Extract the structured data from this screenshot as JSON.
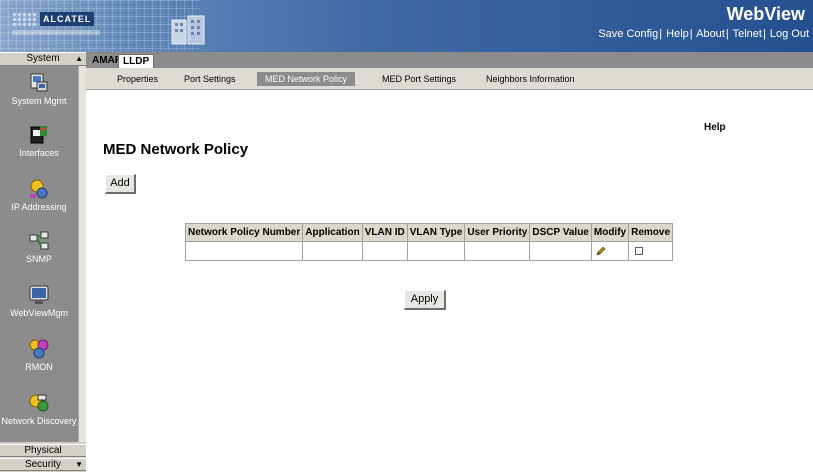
{
  "header": {
    "logo_text": "ALCATEL",
    "app_title": "WebView",
    "links": [
      "Save Config",
      "Help",
      "About",
      "Telnet",
      "Log Out"
    ],
    "separator": "|"
  },
  "sidebar": {
    "top_label": "System",
    "items": [
      {
        "label": "System Mgmt",
        "icon": "system-mgmt-icon"
      },
      {
        "label": "Interfaces",
        "icon": "interfaces-icon"
      },
      {
        "label": "IP Addressing",
        "icon": "ip-addressing-icon"
      },
      {
        "label": "SNMP",
        "icon": "snmp-icon"
      },
      {
        "label": "WebViewMgm",
        "icon": "webview-mgmt-icon"
      },
      {
        "label": "RMON",
        "icon": "rmon-icon"
      },
      {
        "label": "Network Discovery",
        "icon": "network-discovery-icon"
      }
    ],
    "bottom_items": [
      "Physical",
      "Security"
    ]
  },
  "main_tabs": [
    "AMAP",
    "LLDP"
  ],
  "sub_tabs": [
    "Properties",
    "Port Settings",
    "MED Network Policy",
    "MED Port Settings",
    "Neighbors Information"
  ],
  "active_sub_tab": "MED Network Policy",
  "content": {
    "help_label": "Help",
    "title": "MED Network Policy",
    "add_label": "Add",
    "apply_label": "Apply",
    "table": {
      "columns": [
        "Network Policy Number",
        "Application",
        "VLAN ID",
        "VLAN Type",
        "User Priority",
        "DSCP Value",
        "Modify",
        "Remove"
      ],
      "rows": [
        {
          "network_policy_number": "",
          "application": "",
          "vlan_id": "",
          "vlan_type": "",
          "user_priority": "",
          "dscp_value": "",
          "modify_icon": "pencil-icon",
          "remove_checked": false
        }
      ]
    }
  }
}
